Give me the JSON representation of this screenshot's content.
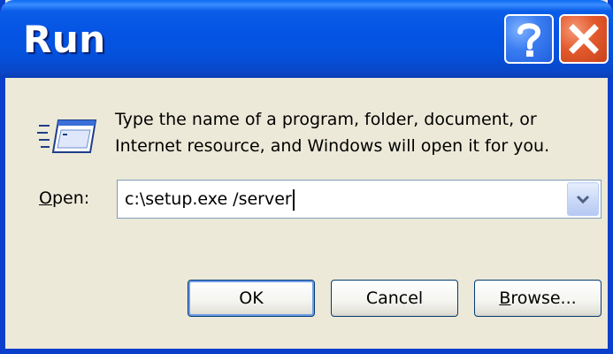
{
  "window": {
    "title": "Run"
  },
  "titlebar": {
    "help_icon": "question-mark-icon",
    "close_icon": "close-x-icon"
  },
  "dialog": {
    "icon": "run-dialog-icon",
    "description_line1": "Type the name of a program, folder, document, or",
    "description_line2": "Internet resource, and Windows will open it for you."
  },
  "open_field": {
    "label_accel": "O",
    "label_rest": "pen:",
    "value": "c:\\setup.exe /server",
    "dropdown_icon": "chevron-down-icon"
  },
  "buttons": {
    "ok": "OK",
    "cancel": "Cancel",
    "browse_accel": "B",
    "browse_rest": "rowse..."
  },
  "colors": {
    "titlebar": "#0554e4",
    "dialog_bg": "#ece9d8",
    "close_button": "#e35a2c",
    "help_button": "#3a7cf0"
  }
}
